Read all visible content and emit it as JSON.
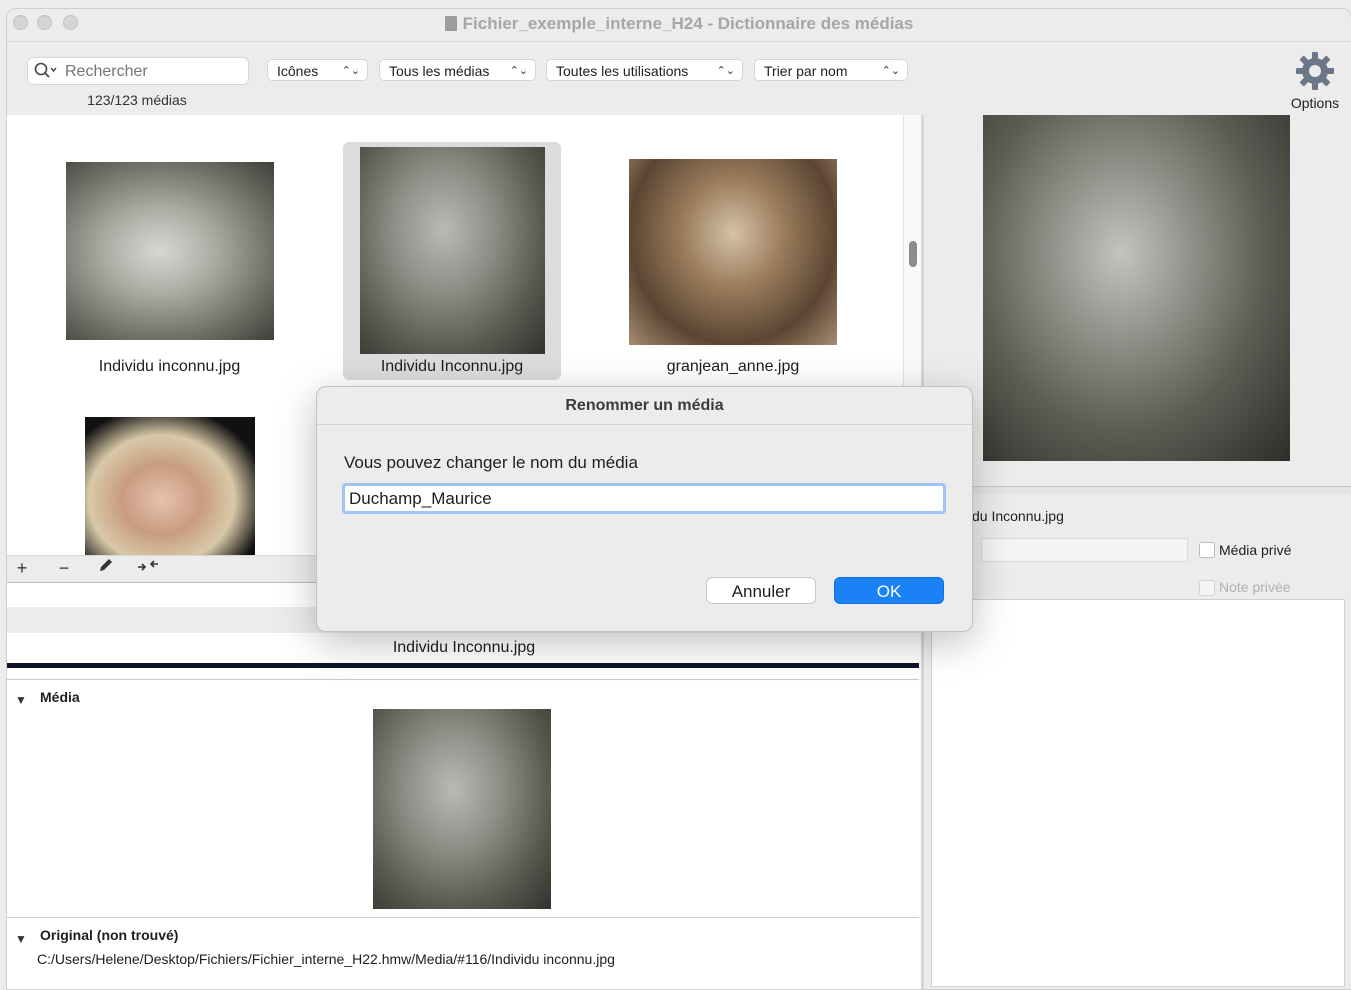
{
  "window": {
    "title": "Fichier_exemple_interne_H24 - Dictionnaire des médias"
  },
  "toolbar": {
    "search_placeholder": "Rechercher",
    "count": "123/123 médias",
    "view_mode": "Icônes",
    "filter_media": "Tous les médias",
    "filter_usage": "Toutes les utilisations",
    "sort": "Trier par nom",
    "options_label": "Options"
  },
  "grid": {
    "items": [
      {
        "caption": "Individu inconnu.jpg",
        "selected": false
      },
      {
        "caption": "Individu Inconnu.jpg",
        "selected": true
      },
      {
        "caption": "granjean_anne.jpg",
        "selected": false
      },
      {
        "caption": "",
        "selected": false
      }
    ]
  },
  "edit_bar": {
    "add": "+",
    "remove": "−"
  },
  "details": {
    "selected_name": "Individu Inconnu.jpg",
    "media_section": "Média",
    "original_section": "Original (non trouvé)",
    "original_path": "C:/Users/Helene/Desktop/Fichiers/Fichier_interne_H22.hmw/Media/#116/Individu inconnu.jpg"
  },
  "right_panel": {
    "name_partial": "du Inconnu.jpg",
    "private_media_label": "Média privé",
    "private_note_label": "Note privée"
  },
  "dialog": {
    "title": "Renommer un média",
    "message": "Vous pouvez changer le nom du média",
    "input_value": "Duchamp_Maurice",
    "cancel_label": "Annuler",
    "ok_label": "OK"
  },
  "colors": {
    "accent": "#1a82f6",
    "focus_ring": "#9fc3f4",
    "window_bg": "#ececec"
  }
}
